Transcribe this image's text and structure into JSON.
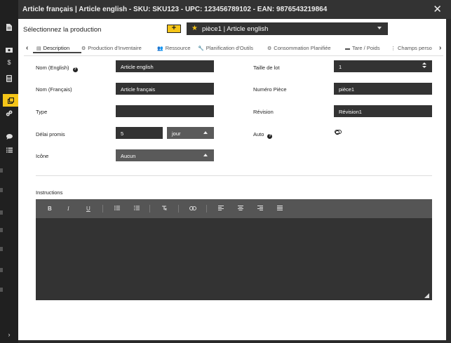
{
  "window": {
    "title": "Article français | Article english - SKU: SKU123 - UPC: 123456789102 - EAN: 9876543219864",
    "close_icon": "close-icon"
  },
  "sidebar": {
    "icons": [
      "document-icon",
      "money-icon",
      "dollar-icon",
      "calculator-icon",
      "copy-icon",
      "cogs-icon",
      "chat-icon",
      "list-icon",
      "expand-icon"
    ]
  },
  "production": {
    "label": "Sélectionnez la production",
    "add_label": "+",
    "selected": "pièce1 | Article english",
    "star_color": "#f5c518"
  },
  "tabs": {
    "items": [
      {
        "label": "Description",
        "icon": "document-icon",
        "active": true
      },
      {
        "label": "Production d'Inventaire",
        "icon": "gear-icon"
      },
      {
        "label": "Ressource",
        "icon": "users-icon"
      },
      {
        "label": "Planification d'Outils",
        "icon": "wrench-icon"
      },
      {
        "label": "Consommation Planifiée",
        "icon": "cogs-icon"
      },
      {
        "label": "Tare / Poids",
        "icon": "scale-icon"
      },
      {
        "label": "Champs perso",
        "icon": "more-icon"
      }
    ]
  },
  "form": {
    "name_en_label": "Nom (English)",
    "name_en_value": "Article english",
    "name_fr_label": "Nom (Français)",
    "name_fr_value": "Article français",
    "type_label": "Type",
    "type_value": "",
    "delay_label": "Délai promis",
    "delay_value": "5",
    "delay_unit": "jour",
    "icon_label": "Icône",
    "icon_value": "Aucun",
    "lot_label": "Taille de lot",
    "lot_value": "1",
    "part_label": "Numéro Pièce",
    "part_value": "pièce1",
    "revision_label": "Révision",
    "revision_value": "Révision1",
    "auto_label": "Auto",
    "auto_on": false
  },
  "instructions": {
    "label": "Instructions",
    "toolbar": {
      "bold": "B",
      "italic": "I",
      "underline": "U"
    },
    "content": ""
  },
  "colors": {
    "accent": "#f5c518",
    "dark_field": "#333333",
    "titlebar": "#333333"
  }
}
